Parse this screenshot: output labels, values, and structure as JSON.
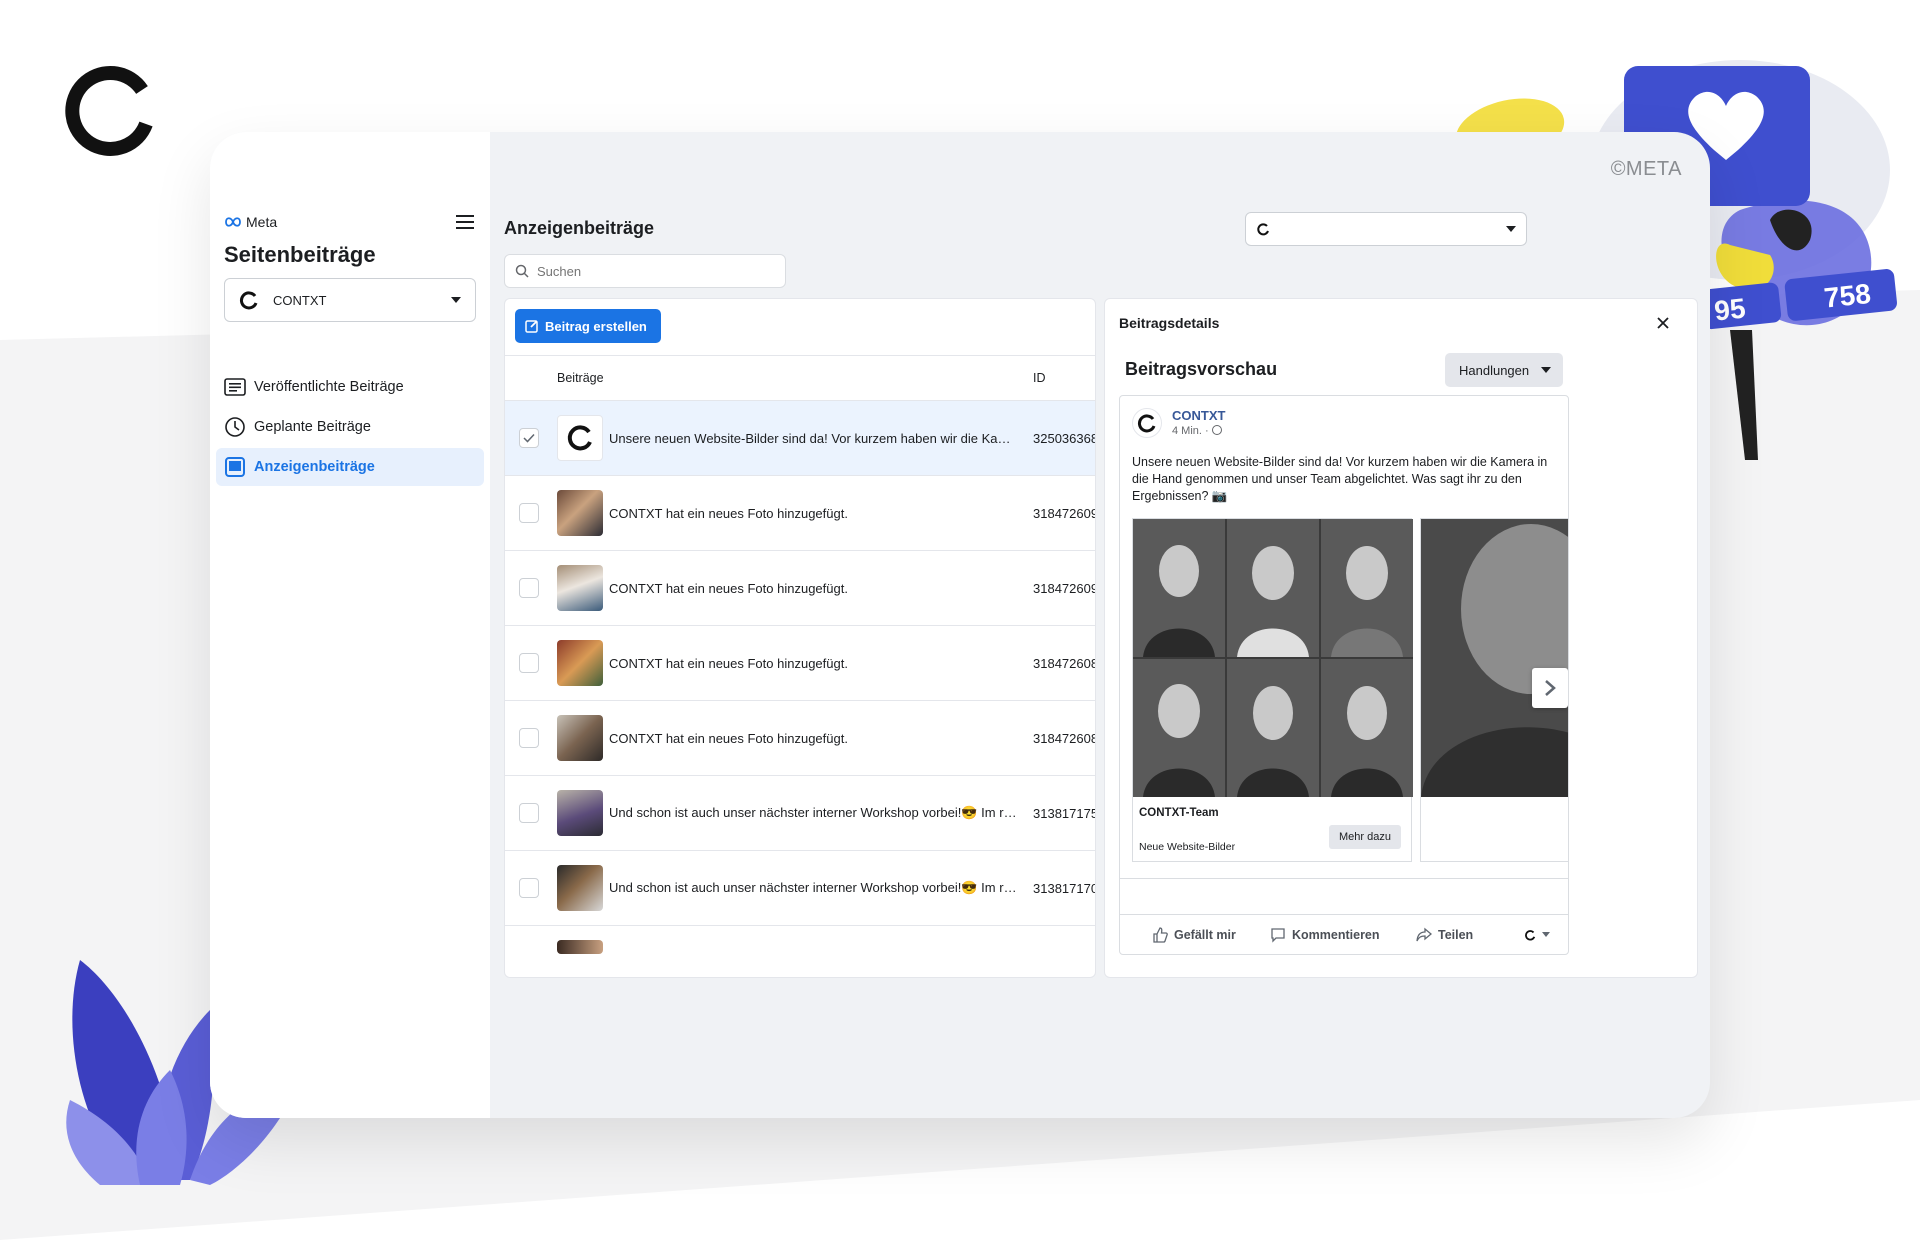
{
  "brand": {
    "accent": "#1b74e4"
  },
  "header": {
    "copyright": "©META"
  },
  "sidebar": {
    "meta_label": "Meta",
    "title": "Seitenbeiträge",
    "page_selector": "CONTXT",
    "items": [
      {
        "label": "Veröffentlichte Beiträge",
        "icon": "list-icon",
        "active": false
      },
      {
        "label": "Geplante Beiträge",
        "icon": "clock-icon",
        "active": false
      },
      {
        "label": "Anzeigenbeiträge",
        "icon": "tablet-icon",
        "active": true
      }
    ]
  },
  "main": {
    "title": "Anzeigenbeiträge",
    "search_placeholder": "Suchen",
    "create_button": "Beitrag erstellen",
    "columns": {
      "posts": "Beiträge",
      "id": "ID"
    },
    "rows": [
      {
        "text": "Unsere neuen Website-Bilder sind da! Vor kurzem haben wir die Kamera in die Hand genommen",
        "id": "325036368",
        "selected": true
      },
      {
        "text": "CONTXT hat ein neues Foto hinzugefügt.",
        "id": "318472609",
        "selected": false
      },
      {
        "text": "CONTXT hat ein neues Foto hinzugefügt.",
        "id": "318472609",
        "selected": false
      },
      {
        "text": "CONTXT hat ein neues Foto hinzugefügt.",
        "id": "318472608",
        "selected": false
      },
      {
        "text": "CONTXT hat ein neues Foto hinzugefügt.",
        "id": "318472608",
        "selected": false
      },
      {
        "text": "Und schon ist auch unser nächster interner Workshop vorbei!😎 Im rahmen",
        "id": "313817175",
        "selected": false
      },
      {
        "text": "Und schon ist auch unser nächster interner Workshop vorbei!😎 Im rahmen",
        "id": "313817170",
        "selected": false
      }
    ]
  },
  "details": {
    "title": "Beitragsdetails",
    "preview_title": "Beitragsvorschau",
    "actions_label": "Handlungen",
    "post": {
      "page_name": "CONTXT",
      "time": "4 Min. ·",
      "text": "Unsere neuen Website-Bilder sind da! Vor kurzem haben wir die Kamera in die Hand genommen und unser Team abgelichtet. Was sagt ihr zu den Ergebnissen? 📷",
      "card": {
        "title": "CONTXT-Team",
        "subtitle": "Neue Website-Bilder",
        "cta": "Mehr dazu"
      },
      "actions": {
        "like": "Gefällt mir",
        "comment": "Kommentieren",
        "share": "Teilen"
      }
    }
  },
  "decoration": {
    "counter_people": "95",
    "counter_likes": "758"
  }
}
